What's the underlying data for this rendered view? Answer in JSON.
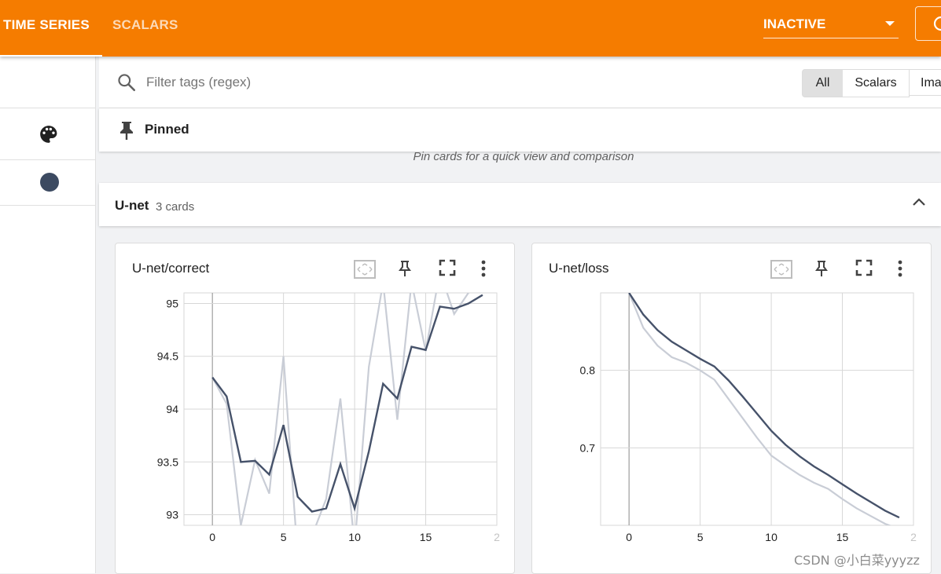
{
  "header": {
    "tabs": [
      {
        "label": "TIME SERIES",
        "active": true
      },
      {
        "label": "SCALARS",
        "active": false
      }
    ],
    "run_select": "INACTIVE",
    "accent_color": "#f57c00"
  },
  "filter": {
    "placeholder": "Filter tags (regex)",
    "segments": [
      "All",
      "Scalars",
      "Ima"
    ],
    "selected": "All"
  },
  "pinned": {
    "title": "Pinned",
    "empty_message": "Pin cards for a quick view and comparison"
  },
  "group": {
    "name": "U-net",
    "count": "3 cards",
    "expanded": true
  },
  "cards": [
    {
      "title": "U-net/correct"
    },
    {
      "title": "U-net/loss"
    }
  ],
  "chart_data": [
    {
      "type": "line",
      "title": "U-net/correct",
      "xlabel": "",
      "ylabel": "",
      "xlim": [
        -2,
        20
      ],
      "ylim": [
        92.9,
        95.1
      ],
      "x_ticks": [
        "0",
        "5",
        "10",
        "15",
        "2"
      ],
      "y_ticks": [
        "95",
        "94.5",
        "94",
        "93.5",
        "93"
      ],
      "grid": true,
      "series": [
        {
          "role": "raw",
          "color": "#c9cdd6",
          "x": [
            0,
            1,
            2,
            3,
            4,
            5,
            6,
            7,
            8,
            9,
            10,
            11,
            12,
            13,
            14,
            15,
            16,
            17,
            18,
            19
          ],
          "y": [
            94.3,
            94.05,
            92.9,
            93.52,
            93.2,
            94.5,
            92.6,
            92.8,
            93.15,
            94.1,
            92.7,
            94.4,
            95.2,
            93.9,
            95.2,
            94.55,
            95.3,
            94.9,
            95.1,
            95.2
          ]
        },
        {
          "role": "smoothed",
          "color": "#46526a",
          "x": [
            0,
            1,
            2,
            3,
            4,
            5,
            6,
            7,
            8,
            9,
            10,
            11,
            12,
            13,
            14,
            15,
            16,
            17,
            18,
            19
          ],
          "y": [
            94.3,
            94.12,
            93.5,
            93.51,
            93.38,
            93.85,
            93.17,
            93.03,
            93.06,
            93.48,
            93.06,
            93.6,
            94.24,
            94.1,
            94.59,
            94.56,
            94.97,
            94.95,
            95.0,
            95.08
          ]
        }
      ]
    },
    {
      "type": "line",
      "title": "U-net/loss",
      "xlabel": "",
      "ylabel": "",
      "xlim": [
        -2,
        20
      ],
      "ylim": [
        0.6,
        0.9
      ],
      "x_ticks": [
        "0",
        "5",
        "10",
        "15",
        "2"
      ],
      "y_ticks": [
        "0.8",
        "0.7"
      ],
      "grid": true,
      "series": [
        {
          "role": "raw",
          "color": "#c9cdd6",
          "x": [
            0,
            1,
            2,
            3,
            4,
            5,
            6,
            7,
            8,
            9,
            10,
            11,
            12,
            13,
            14,
            15,
            16,
            17,
            18,
            19
          ],
          "y": [
            0.9,
            0.855,
            0.832,
            0.817,
            0.81,
            0.8,
            0.788,
            0.763,
            0.738,
            0.713,
            0.69,
            0.677,
            0.665,
            0.655,
            0.647,
            0.634,
            0.622,
            0.612,
            0.602,
            0.595
          ]
        },
        {
          "role": "smoothed",
          "color": "#46526a",
          "x": [
            0,
            1,
            2,
            3,
            4,
            5,
            6,
            7,
            8,
            9,
            10,
            11,
            12,
            13,
            14,
            15,
            16,
            17,
            18,
            19
          ],
          "y": [
            0.9,
            0.872,
            0.852,
            0.837,
            0.826,
            0.815,
            0.805,
            0.787,
            0.766,
            0.744,
            0.722,
            0.704,
            0.689,
            0.676,
            0.665,
            0.653,
            0.641,
            0.63,
            0.619,
            0.61
          ]
        }
      ]
    }
  ]
}
